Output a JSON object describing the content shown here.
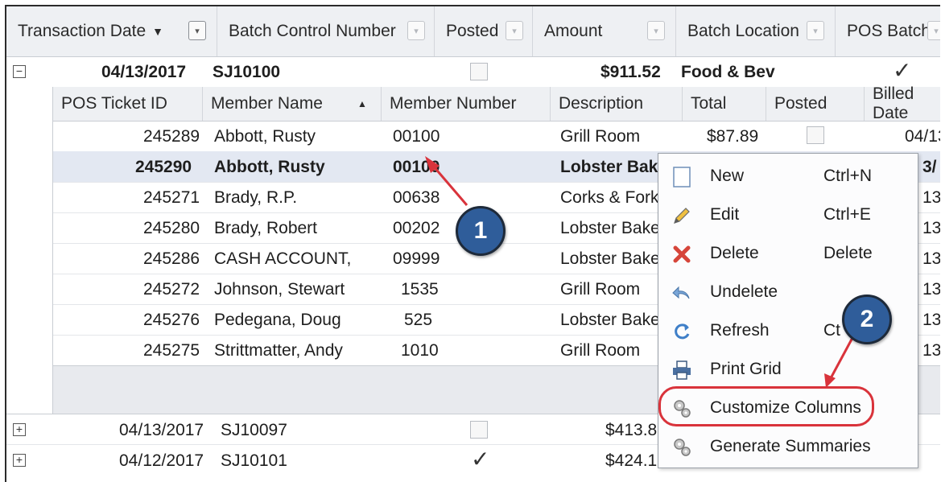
{
  "main_header": {
    "transaction_date": "Transaction Date",
    "batch_control_number": "Batch Control Number",
    "posted": "Posted",
    "amount": "Amount",
    "batch_location": "Batch Location",
    "pos_batch": "POS Batch"
  },
  "batches": [
    {
      "expander": "−",
      "date": "04/13/2017",
      "batch": "SJ10100",
      "posted": false,
      "amount": "$911.52",
      "location": "Food & Bev",
      "pos_batch": true
    },
    {
      "expander": "+",
      "date": "04/13/2017",
      "batch": "SJ10097",
      "posted": false,
      "amount": "$413.8"
    },
    {
      "expander": "+",
      "date": "04/12/2017",
      "batch": "SJ10101",
      "posted": true,
      "amount": "$424.1"
    }
  ],
  "detail_header": {
    "pos_ticket_id": "POS Ticket ID",
    "member_name": "Member Name",
    "member_number": "Member Number",
    "description": "Description",
    "total": "Total",
    "posted": "Posted",
    "billed_date": "Billed Date"
  },
  "detail_rows": [
    {
      "id": "245289",
      "name": "Abbott, Rusty",
      "number": "00100",
      "desc": "Grill Room",
      "total": "$87.89",
      "billed": "04/13/"
    },
    {
      "id": "245290",
      "name": "Abbott, Rusty",
      "number": "00100",
      "desc": "Lobster Bake",
      "billed": "3/"
    },
    {
      "id": "245271",
      "name": "Brady, R.P.",
      "number": "00638",
      "desc": "Corks & Forks",
      "billed": "13/"
    },
    {
      "id": "245280",
      "name": "Brady, Robert",
      "number": "00202",
      "desc": "Lobster Bake",
      "billed": "13/"
    },
    {
      "id": "245286",
      "name": "CASH ACCOUNT,",
      "number": "09999",
      "desc": "Lobster Bake",
      "billed": "13/"
    },
    {
      "id": "245272",
      "name": "Johnson, Stewart",
      "number": "1535",
      "desc": "Grill Room",
      "billed": "13/"
    },
    {
      "id": "245276",
      "name": "Pedegana, Doug",
      "number": "525",
      "desc": "Lobster Bake",
      "billed": "13/"
    },
    {
      "id": "245275",
      "name": "Strittmatter, Andy",
      "number": "1010",
      "desc": "Grill Room",
      "billed": "13/"
    }
  ],
  "context_menu": {
    "new": "New",
    "new_sc": "Ctrl+N",
    "edit": "Edit",
    "edit_sc": "Ctrl+E",
    "delete": "Delete",
    "delete_sc": "Delete",
    "undelete": "Undelete",
    "refresh": "Refresh",
    "refresh_sc": "Ct",
    "print_grid": "Print Grid",
    "customize_columns": "Customize Columns",
    "generate_summaries": "Generate Summaries"
  },
  "callouts": {
    "one": "1",
    "two": "2"
  },
  "colors": {
    "callout": "#2f5d9a",
    "highlight": "#d9333b",
    "arrow": "#d9333b",
    "selected_row": "#e3e8f2"
  }
}
